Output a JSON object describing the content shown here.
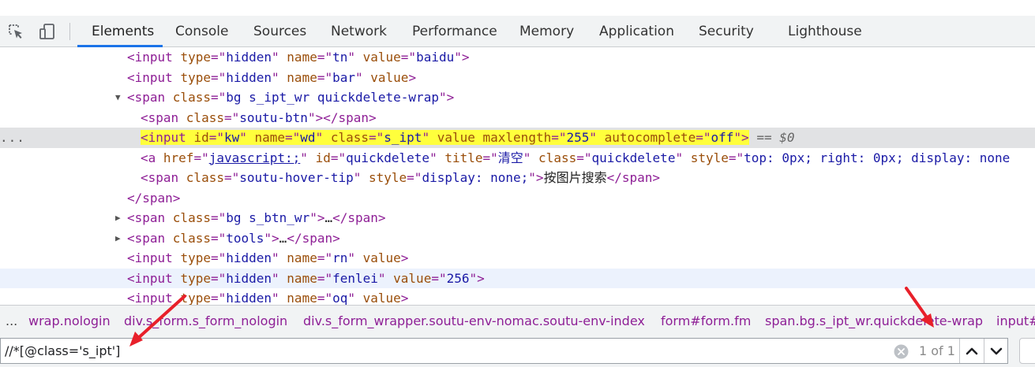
{
  "tabs": [
    "Elements",
    "Console",
    "Sources",
    "Network",
    "Performance",
    "Memory",
    "Application",
    "Security",
    "Lighthouse"
  ],
  "icons": {
    "inspect": "inspect-element-icon",
    "device": "device-toolbar-icon",
    "clear": "clear-search-icon",
    "prev": "chevron-up-icon",
    "next": "chevron-down-icon"
  },
  "colors": {
    "active_tab_underline": "#1a73e8",
    "highlight": "#ffff3c",
    "tag": "#8e1f96",
    "attr_name": "#9a4e0a",
    "attr_value": "#1a1aa6",
    "annotation_arrow": "#e8202a"
  },
  "dom": {
    "row0": {
      "t1": "<input ",
      "a1": "type",
      "t2": "=\"",
      "v1": "hidden",
      "t3": "\" ",
      "a2": "name",
      "t4": "=\"",
      "v2": "tn",
      "t5": "\" ",
      "a3": "value",
      "t6": "=\"",
      "v3": "baidu",
      "t7": "\">"
    },
    "row1": {
      "t1": "<input ",
      "a1": "type",
      "t2": "=\"",
      "v1": "hidden",
      "t3": "\" ",
      "a2": "name",
      "t4": "=\"",
      "v2": "bar",
      "t5": "\" ",
      "a3": "value",
      "t6": ">"
    },
    "row2": {
      "t1": "<span ",
      "a1": "class",
      "t2": "=\"",
      "v1": "bg s_ipt_wr quickdelete-wrap",
      "t3": "\">"
    },
    "row3": {
      "t1": "<span ",
      "a1": "class",
      "t2": "=\"",
      "v1": "soutu-btn",
      "t3": "\"></span>"
    },
    "row4": {
      "dots": "...",
      "t1": "<input ",
      "a1": "id",
      "t2": "=\"",
      "v1": "kw",
      "t3": "\" ",
      "a2": "name",
      "t4": "=\"",
      "v2": "wd",
      "t5": "\" ",
      "a3": "class",
      "t6": "=\"",
      "v3": "s_ipt",
      "t7": "\" ",
      "a4": "value",
      "t8": " ",
      "a5": "maxlength",
      "t9": "=\"",
      "v5": "255",
      "t10": "\" ",
      "a6": "autocomplete",
      "t11": "=\"",
      "v6": "off",
      "t12": "\">",
      "eq0": " == $0"
    },
    "row5": {
      "t1": "<a ",
      "a1": "href",
      "t2": "=\"",
      "v1": "javascript:;",
      "t3": "\" ",
      "a2": "id",
      "t4": "=\"",
      "v2": "quickdelete",
      "t5": "\" ",
      "a3": "title",
      "t6": "=\"",
      "v3": "清空",
      "t7": "\" ",
      "a4": "class",
      "t8": "=\"",
      "v4": "quickdelete",
      "t9": "\" ",
      "a5": "style",
      "t10": "=\"",
      "v5": "top: 0px; right: 0px; display: none"
    },
    "row6": {
      "t1": "<span ",
      "a1": "class",
      "t2": "=\"",
      "v1": "soutu-hover-tip",
      "t3": "\" ",
      "a2": "style",
      "t4": "=\"",
      "v2": "display: none;",
      "t5": "\">",
      "tx": "按图片搜索",
      "t6": "</span>"
    },
    "row7": {
      "t1": "</span>"
    },
    "row8": {
      "t1": "<span ",
      "a1": "class",
      "t2": "=\"",
      "v1": "bg s_btn_wr",
      "t3": "\">",
      "tx": "…",
      "t4": "</span>"
    },
    "row9": {
      "t1": "<span ",
      "a1": "class",
      "t2": "=\"",
      "v1": "tools",
      "t3": "\">",
      "tx": "…",
      "t4": "</span>"
    },
    "row10": {
      "t1": "<input ",
      "a1": "type",
      "t2": "=\"",
      "v1": "hidden",
      "t3": "\" ",
      "a2": "name",
      "t4": "=\"",
      "v2": "rn",
      "t5": "\" ",
      "a3": "value",
      "t6": ">"
    },
    "row11": {
      "t1": "<input ",
      "a1": "type",
      "t2": "=\"",
      "v1": "hidden",
      "t3": "\" ",
      "a2": "name",
      "t4": "=\"",
      "v2": "fenlei",
      "t5": "\" ",
      "a3": "value",
      "t6": "=\"",
      "v3": "256",
      "t7": "\">"
    },
    "row12": {
      "t1": "<input ",
      "a1": "type",
      "t2": "=\"",
      "v1": "hidden",
      "t3": "\" ",
      "a2": "name",
      "t4": "=\"",
      "v2": "oq",
      "t5": "\" ",
      "a3": "value",
      "t6": ">"
    }
  },
  "breadcrumbs": {
    "overflow": "...",
    "items": [
      "wrap.nologin",
      "div.s_form.s_form_nologin",
      "div.s_form_wrapper.soutu-env-nomac.soutu-env-index",
      "form#form.fm",
      "span.bg.s_ipt_wr.quickdelete-wrap",
      "input#"
    ]
  },
  "search": {
    "value": "//*[@class='s_ipt']",
    "match_count": "1 of 1"
  }
}
